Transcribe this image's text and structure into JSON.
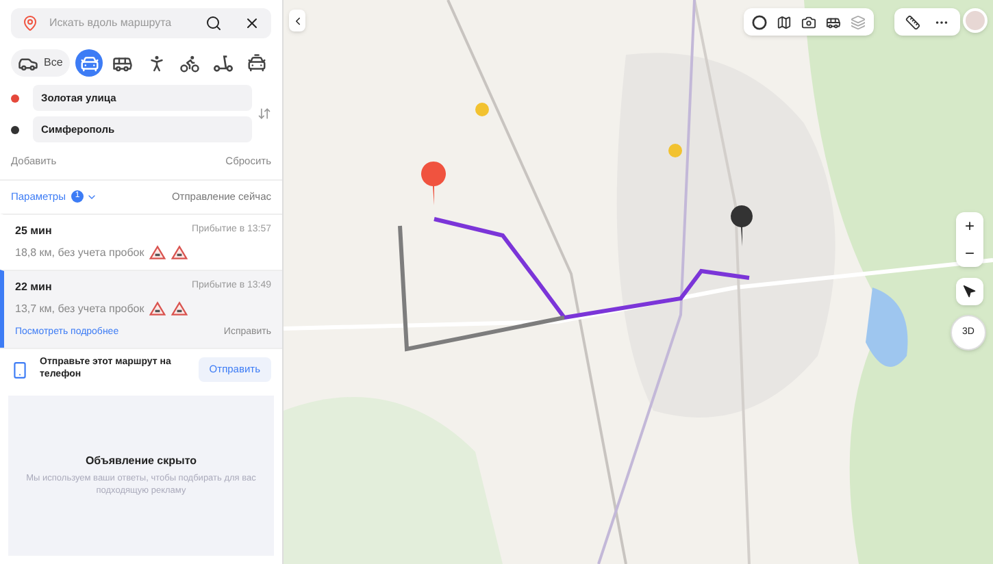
{
  "search": {
    "placeholder": "Искать вдоль маршрута"
  },
  "modes": [
    {
      "kind": "all",
      "label": "Все",
      "selected": false
    },
    {
      "kind": "car",
      "selected": true
    },
    {
      "kind": "bus",
      "selected": false
    },
    {
      "kind": "walk",
      "selected": false
    },
    {
      "kind": "bike",
      "selected": false
    },
    {
      "kind": "scooter",
      "selected": false
    },
    {
      "kind": "taxi",
      "selected": false
    }
  ],
  "waypoints": [
    {
      "value": "Золотая улица",
      "color": "#e5483b"
    },
    {
      "value": "Симферополь",
      "color": "#333333"
    }
  ],
  "add_link": "Добавить",
  "reset_link": "Сбросить",
  "params": {
    "label": "Параметры",
    "count": "1"
  },
  "departure": "Отправление сейчас",
  "routes": [
    {
      "duration": "25 мин",
      "arrival": "Прибытие в 13:57",
      "distance": "18,8 км, без учета пробок",
      "selected": false
    },
    {
      "duration": "22 мин",
      "arrival": "Прибытие в 13:49",
      "distance": "13,7 км, без учета пробок",
      "selected": true,
      "details_link": "Посмотреть подробнее",
      "fix_link": "Исправить"
    }
  ],
  "send": {
    "text": "Отправьте этот маршрут на телефон",
    "button": "Отправить"
  },
  "ad": {
    "title": "Объявление скрыто",
    "text": "Мы используем ваши ответы, чтобы подбирать для вас подходящую рекламу"
  },
  "map_controls": {
    "zoom_in": "+",
    "zoom_out": "−",
    "view_3d": "3D"
  }
}
